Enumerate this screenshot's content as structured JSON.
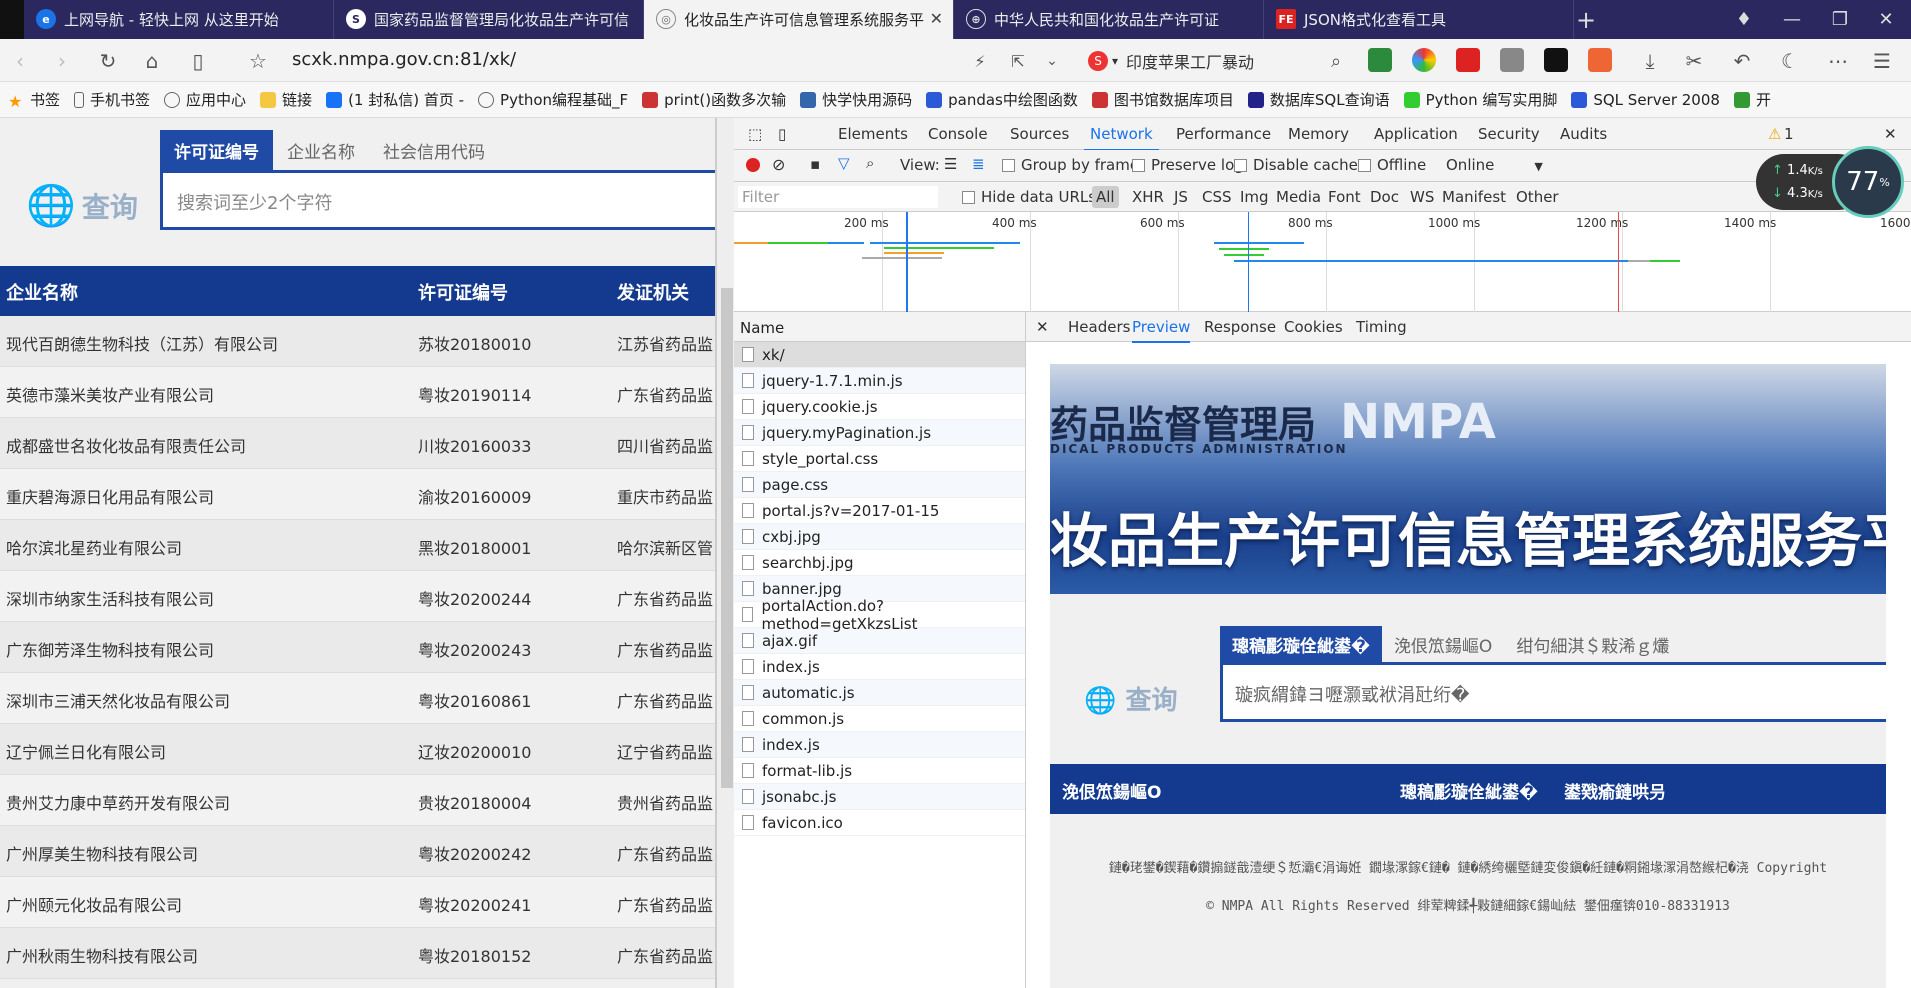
{
  "tabs": [
    {
      "title": "上网导航 - 轻快上网 从这里开始",
      "icon": "globe-e-icon"
    },
    {
      "title": "国家药品监督管理局化妆品生产许可信",
      "icon": "s-logo-icon"
    },
    {
      "title": "化妆品生产许可信息管理系统服务平",
      "icon": "page-icon",
      "active": true
    },
    {
      "title": "中华人民共和国化妆品生产许可证",
      "icon": "globe-icon"
    },
    {
      "title": "JSON格式化查看工具",
      "icon": "fe-logo-icon"
    }
  ],
  "address": {
    "url": "scxk.nmpa.gov.cn:81/xk/",
    "search_text": "印度苹果工厂暴动"
  },
  "bookmarks": [
    {
      "label": "书签"
    },
    {
      "label": "手机书签"
    },
    {
      "label": "应用中心"
    },
    {
      "label": "链接"
    },
    {
      "label": "(1 封私信) 首页 -"
    },
    {
      "label": "Python编程基础_F"
    },
    {
      "label": "print()函数多次输"
    },
    {
      "label": "快学快用源码"
    },
    {
      "label": "pandas中绘图函数"
    },
    {
      "label": "图书馆数据库项目"
    },
    {
      "label": "数据库SQL查询语"
    },
    {
      "label": "Python 编写实用脚"
    },
    {
      "label": "SQL Server 2008"
    },
    {
      "label": "开"
    }
  ],
  "page": {
    "logo_text": "查询",
    "search_tabs": [
      "许可证编号",
      "企业名称",
      "社会信用代码"
    ],
    "search_placeholder": "搜索词至少2个字符",
    "columns": [
      "企业名称",
      "许可证编号",
      "发证机关"
    ],
    "rows": [
      [
        "现代百朗德生物科技（江苏）有限公司",
        "苏妆20180010",
        "江苏省药品监"
      ],
      [
        "英德市藻米美妆产业有限公司",
        "粤妆20190114",
        "广东省药品监"
      ],
      [
        "成都盛世名妆化妆品有限责任公司",
        "川妆20160033",
        "四川省药品监"
      ],
      [
        "重庆碧海源日化用品有限公司",
        "渝妆20160009",
        "重庆市药品监"
      ],
      [
        "哈尔滨北星药业有限公司",
        "黑妆20180001",
        "哈尔滨新区管"
      ],
      [
        "深圳市纳家生活科技有限公司",
        "粤妆20200244",
        "广东省药品监"
      ],
      [
        "广东御芳泽生物科技有限公司",
        "粤妆20200243",
        "广东省药品监"
      ],
      [
        "深圳市三浦天然化妆品有限公司",
        "粤妆20160861",
        "广东省药品监"
      ],
      [
        "辽宁佩兰日化有限公司",
        "辽妆20200010",
        "辽宁省药品监"
      ],
      [
        "贵州艾力康中草药开发有限公司",
        "贵妆20180004",
        "贵州省药品监"
      ],
      [
        "广州厚美生物科技有限公司",
        "粤妆20200242",
        "广东省药品监"
      ],
      [
        "广州颐元化妆品有限公司",
        "粤妆20200241",
        "广东省药品监"
      ],
      [
        "广州秋雨生物科技有限公司",
        "粤妆20180152",
        "广东省药品监"
      ]
    ]
  },
  "devtools": {
    "tabs": [
      "Elements",
      "Console",
      "Sources",
      "Network",
      "Performance",
      "Memory",
      "Application",
      "Security",
      "Audits"
    ],
    "active_tab": "Network",
    "warning_count": "1",
    "toolbar": {
      "view_label": "View:",
      "group_by_frame": "Group by frame",
      "preserve_log": "Preserve log",
      "disable_cache": "Disable cache",
      "offline": "Offline",
      "throttle": "Online"
    },
    "filter": {
      "placeholder": "Filter",
      "hide_data_urls": "Hide data URLs",
      "types": [
        "All",
        "XHR",
        "JS",
        "CSS",
        "Img",
        "Media",
        "Font",
        "Doc",
        "WS",
        "Manifest",
        "Other"
      ]
    },
    "timeline_ticks": [
      "200 ms",
      "400 ms",
      "600 ms",
      "800 ms",
      "1000 ms",
      "1200 ms",
      "1400 ms",
      "1600"
    ],
    "name_header": "Name",
    "requests": [
      "xk/",
      "jquery-1.7.1.min.js",
      "jquery.cookie.js",
      "jquery.myPagination.js",
      "style_portal.css",
      "page.css",
      "portal.js?v=2017-01-15",
      "cxbj.jpg",
      "searchbj.jpg",
      "banner.jpg",
      "portalAction.do?method=getXkzsList",
      "ajax.gif",
      "index.js",
      "automatic.js",
      "common.js",
      "index.js",
      "format-lib.js",
      "jsonabc.js",
      "favicon.ico"
    ],
    "detail_tabs": [
      "Headers",
      "Preview",
      "Response",
      "Cookies",
      "Timing"
    ],
    "active_detail_tab": "Preview",
    "preview": {
      "banner_cn": "药品监督管理局",
      "banner_en": "NMPA",
      "banner_sub": "DICAL PRODUCTS ADMINISTRATION",
      "banner_title": "妆品生产许可信息管理系统服务平",
      "logo_text": "查询",
      "tabs": [
        "璁稿彲璇佺紪鍙�",
        "浼佷笟鍚嶇О",
        "绀句細淇＄敤浠ｇ爜"
      ],
      "search_text": "璇疯緭鍏ヨ嚦灏戜袱涓瓧绗�",
      "columns": [
        "浼佷笟鍚嶇О",
        "璁稿彲璇佺紪鍙�",
        "鍙戣瘉鏈哄叧"
      ],
      "footer_line1": "鏈�珯鐢�鍥藉�鑽搧鐩戠潱绠＄悊灞€涓诲姙 鐗堟潈鎵€鏈� 鏈�綉绔欐墍鏈変俊鎭�紝鏈�粡鎺堟潈涓嶅緱杞�浇 Copyright",
      "footer_line2": "© NMPA All Rights Reserved 绯荤粺鍒╃敤鏈細鎵€鍚屾紶 鐢佃瘽锛010-88331913"
    }
  },
  "speed": {
    "up": "1.4",
    "down": "4.3",
    "unit": "K/s",
    "percent": "77"
  }
}
